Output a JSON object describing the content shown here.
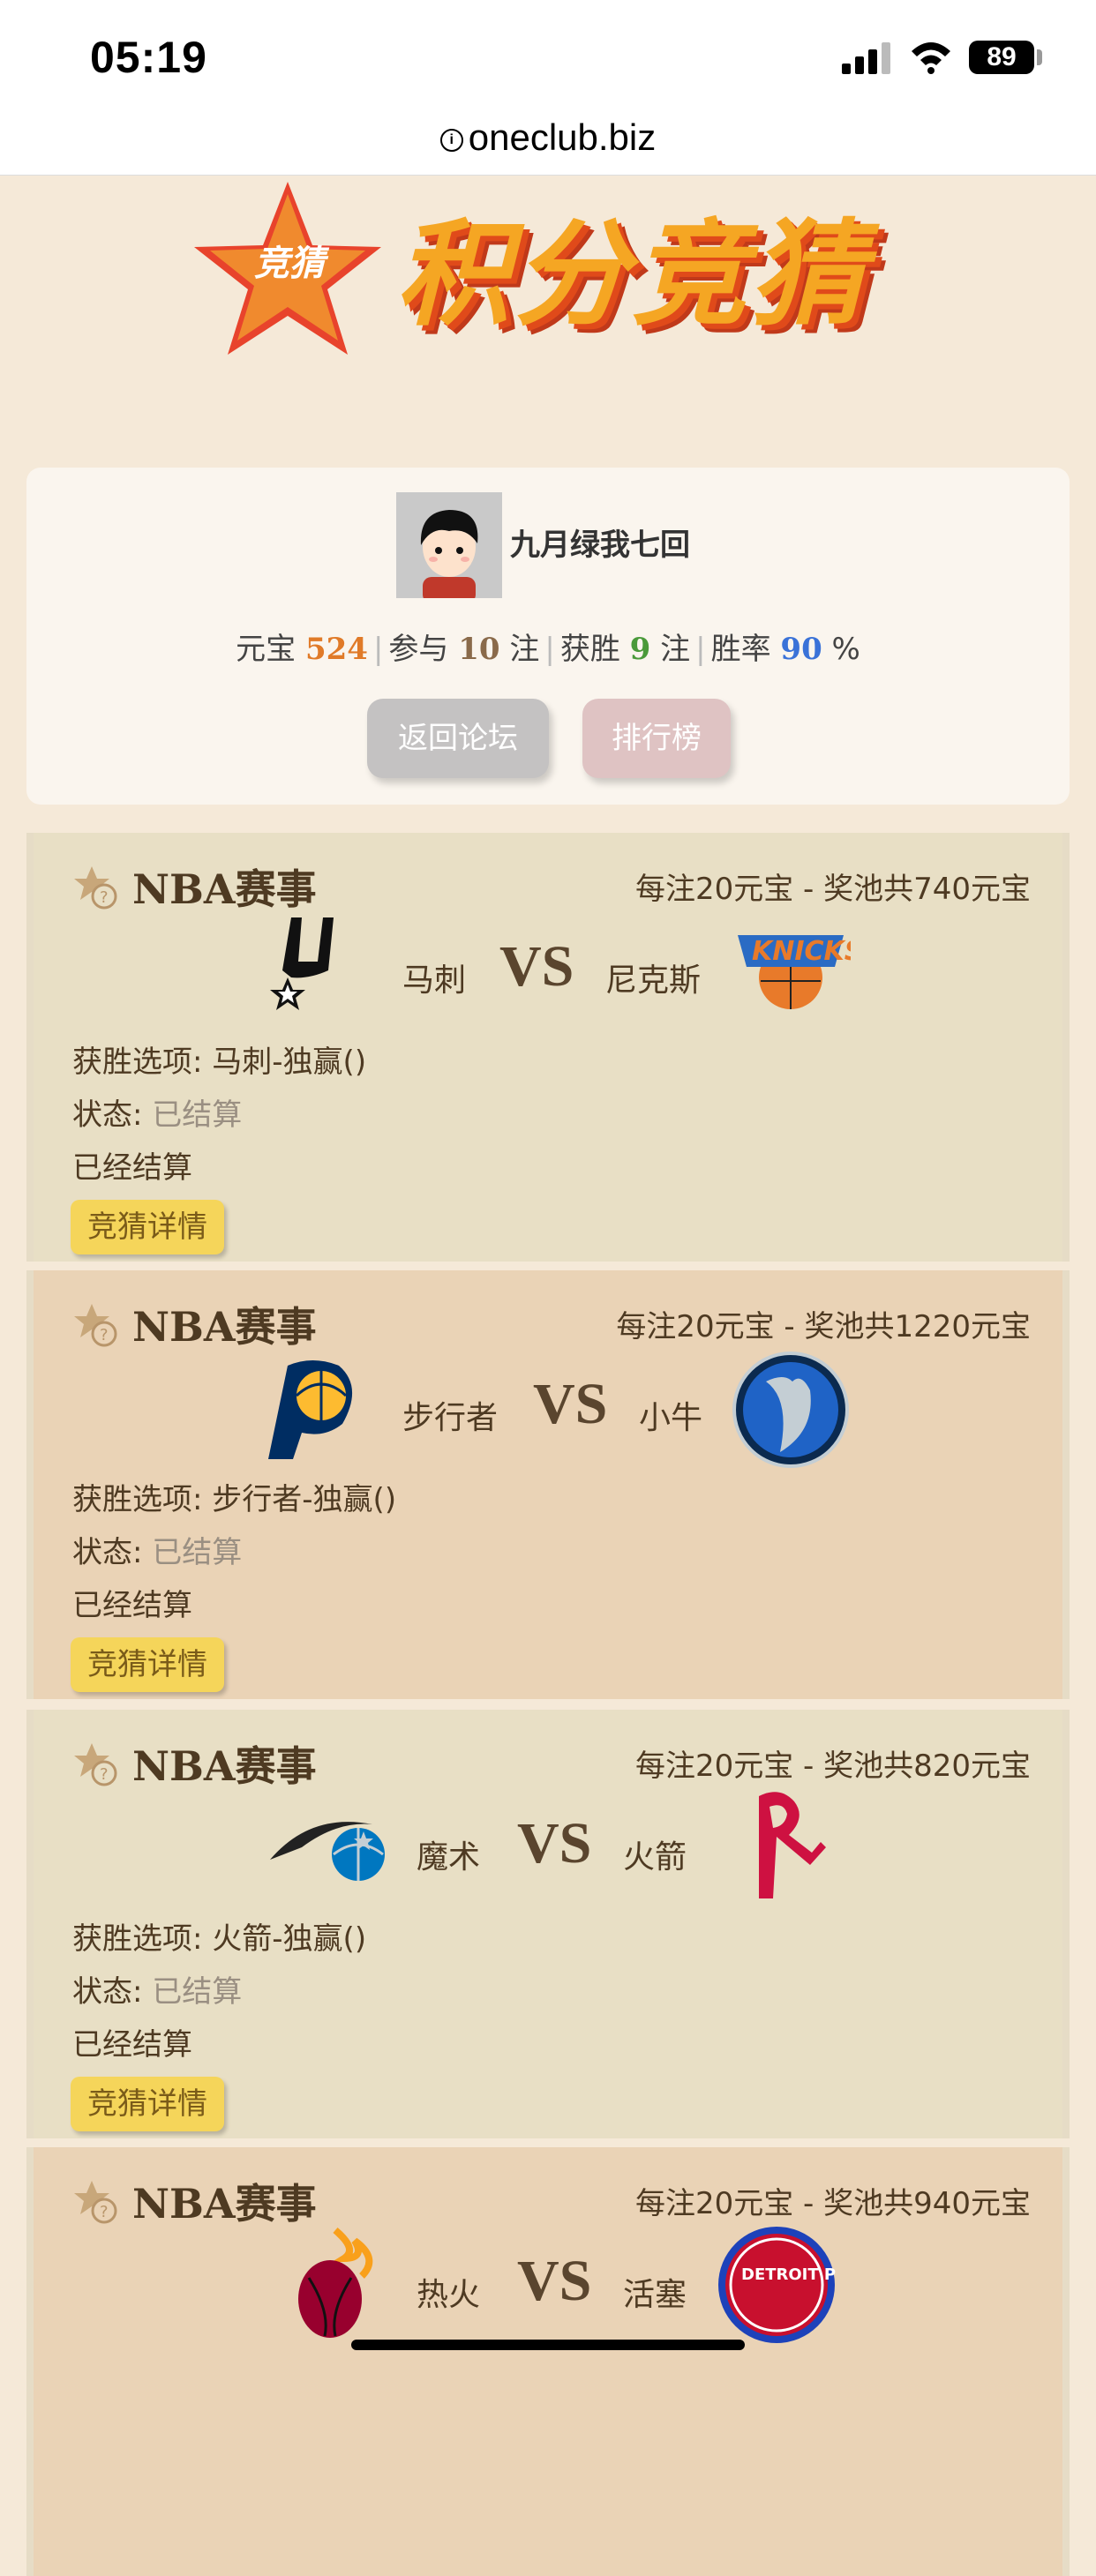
{
  "status_bar": {
    "time": "05:19",
    "battery": "89"
  },
  "browser": {
    "url": "oneclub.biz"
  },
  "banner": {
    "title": "积分竞猜",
    "star_label": "竞猜"
  },
  "user": {
    "name": "九月绿我七回",
    "stats": {
      "yuanbao_label": "元宝",
      "yuanbao": "524",
      "joined_label": "参与",
      "joined": "10",
      "joined_unit": "注",
      "wins_label": "获胜",
      "wins": "9",
      "wins_unit": "注",
      "rate_label": "胜率",
      "rate": "90",
      "rate_unit": "%"
    },
    "back_button": "返回论坛",
    "rank_button": "排行榜"
  },
  "labels": {
    "winner_prefix": "获胜选项:",
    "status_prefix": "状态:",
    "vs": "VS",
    "detail_button": "竞猜详情"
  },
  "matches": [
    {
      "league": "NBA赛事",
      "pool": "每注20元宝 - 奖池共740元宝",
      "home": "马刺",
      "away": "尼克斯",
      "winner": "马刺-独赢()",
      "status": "已结算",
      "note": "已经结算",
      "home_logo": "spurs-logo",
      "away_logo": "knicks-logo"
    },
    {
      "league": "NBA赛事",
      "pool": "每注20元宝 - 奖池共1220元宝",
      "home": "步行者",
      "away": "小牛",
      "winner": "步行者-独赢()",
      "status": "已结算",
      "note": "已经结算",
      "home_logo": "pacers-logo",
      "away_logo": "mavericks-logo"
    },
    {
      "league": "NBA赛事",
      "pool": "每注20元宝 - 奖池共820元宝",
      "home": "魔术",
      "away": "火箭",
      "winner": "火箭-独赢()",
      "status": "已结算",
      "note": "已经结算",
      "home_logo": "magic-logo",
      "away_logo": "rockets-logo"
    },
    {
      "league": "NBA赛事",
      "pool": "每注20元宝 - 奖池共940元宝",
      "home": "热火",
      "away": "活塞",
      "winner": "",
      "status": "",
      "note": "",
      "home_logo": "heat-logo",
      "away_logo": "pistons-logo",
      "away_logo_text": "DETROIT PISTONS"
    }
  ],
  "colors": {
    "yuanbao": "#e07a28",
    "joined": "#8a6a4a",
    "wins": "#4a9a3a",
    "rate": "#3a72d8"
  }
}
